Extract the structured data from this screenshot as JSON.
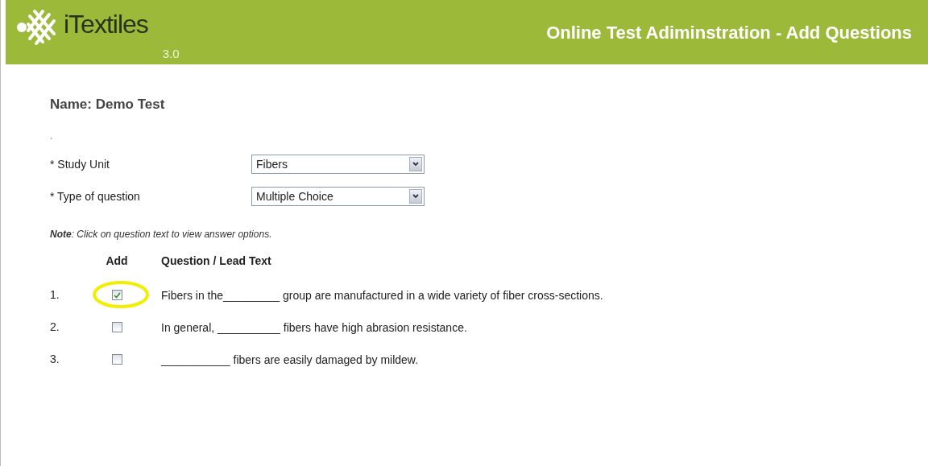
{
  "header": {
    "logo_text": "iTextiles",
    "version": "3.0",
    "title": "Online Test Adiminstration - Add Questions"
  },
  "test_name": "Name: Demo Test",
  "separator_mark": ".",
  "fields": [
    {
      "label": "* Study Unit",
      "value": "Fibers"
    },
    {
      "label": "* Type of question",
      "value": "Multiple Choice"
    }
  ],
  "note": "**Note**: Click on question text to view answer options.",
  "table": {
    "columns": [
      "Add",
      "Question / Lead Text"
    ],
    "rows": [
      {
        "number": "1.",
        "checked": true,
        "highlighted": true,
        "text": "Fibers in the_________ group are manufactured in a wide variety of fiber cross-sections."
      },
      {
        "number": "2.",
        "checked": false,
        "highlighted": false,
        "text": "In general, __________ fibers have high abrasion resistance."
      },
      {
        "number": "3.",
        "checked": false,
        "highlighted": false,
        "text": "___________ fibers are easily damaged by mildew."
      }
    ]
  }
}
